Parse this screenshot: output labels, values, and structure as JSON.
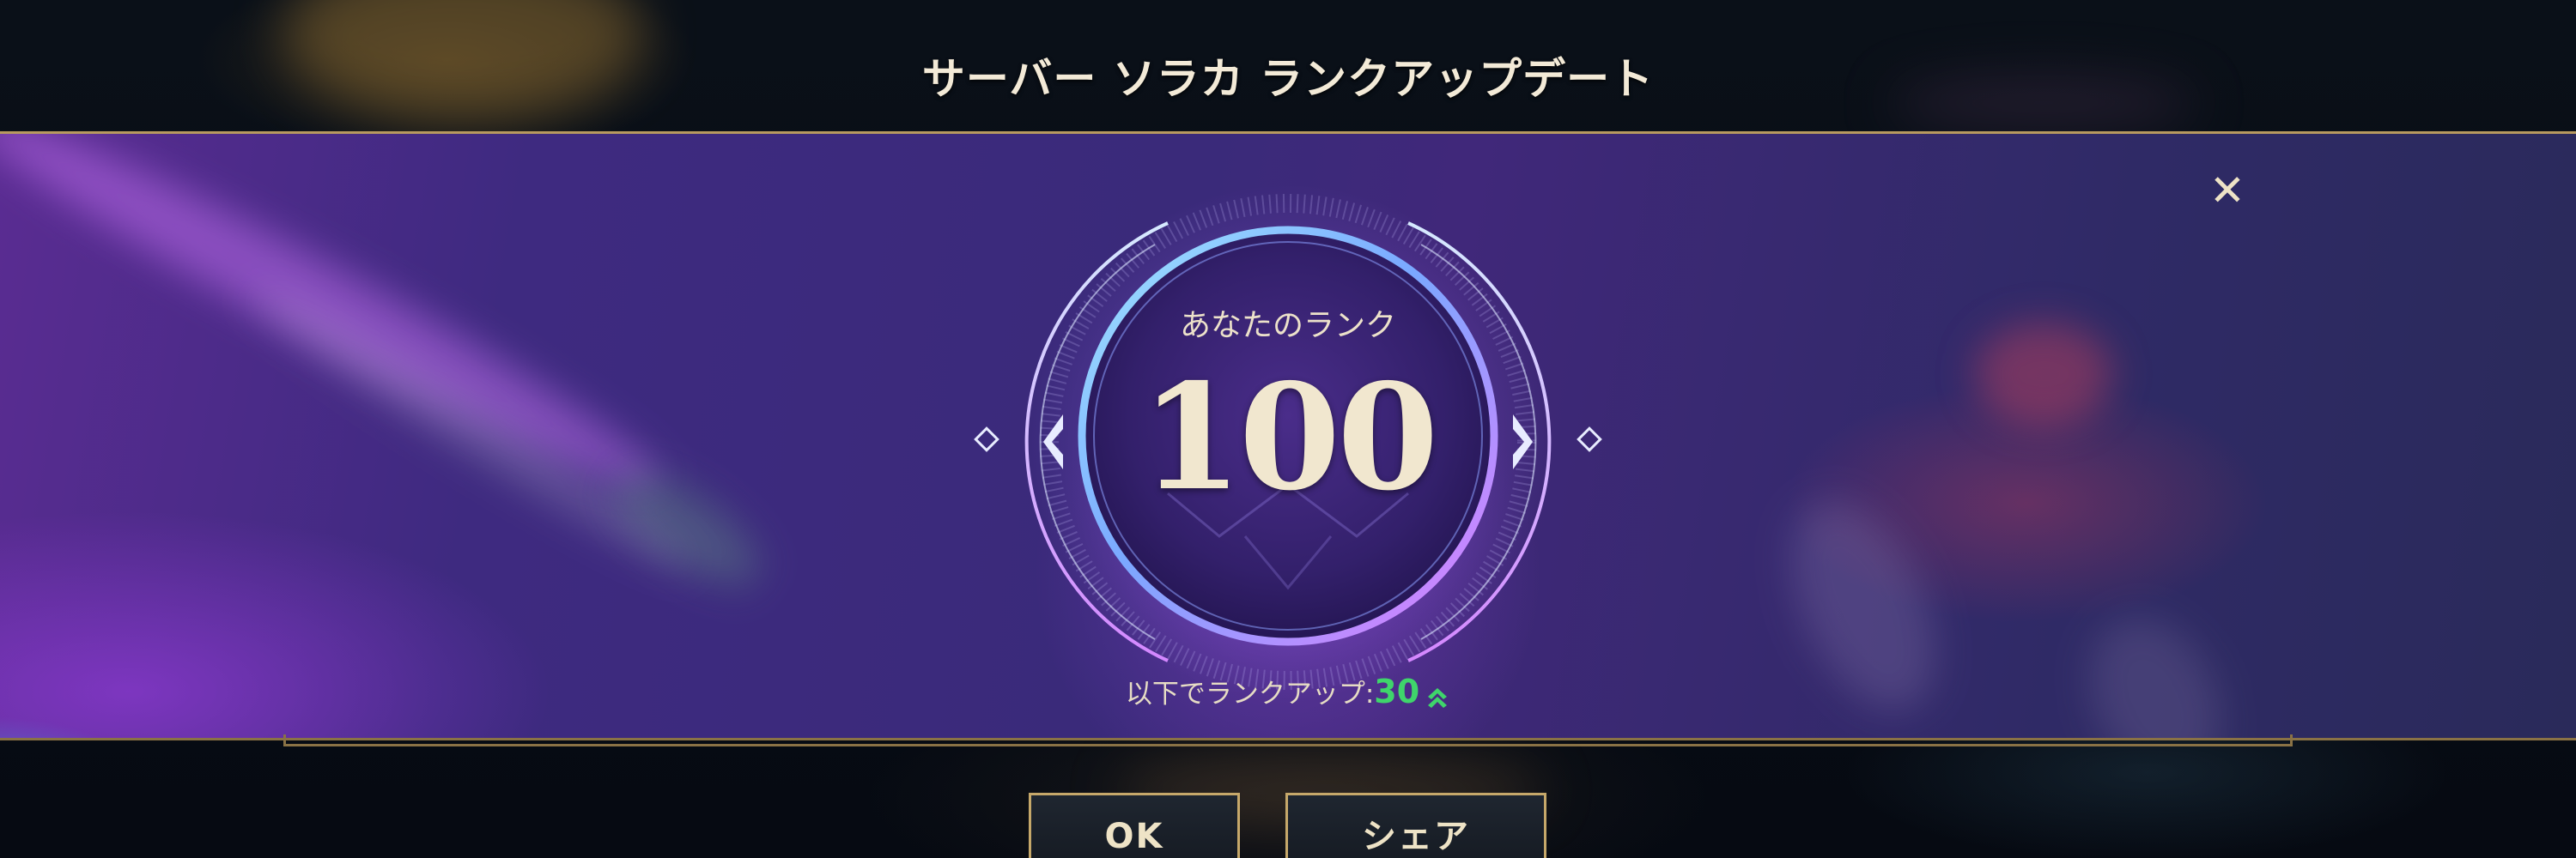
{
  "header": {
    "title": "サーバー ソラカ ランクアップデート"
  },
  "rank_card": {
    "label": "あなたのランク",
    "rank": "100",
    "rankup_text": "以下でランクアップ:",
    "rankup_value": "30",
    "rankup_icon": "double-chevron-up-icon",
    "accent_color": "#3fd56b"
  },
  "close": {
    "icon": "close-icon",
    "glyph": "✕"
  },
  "buttons": {
    "ok_label": "OK",
    "share_label": "シェア"
  }
}
